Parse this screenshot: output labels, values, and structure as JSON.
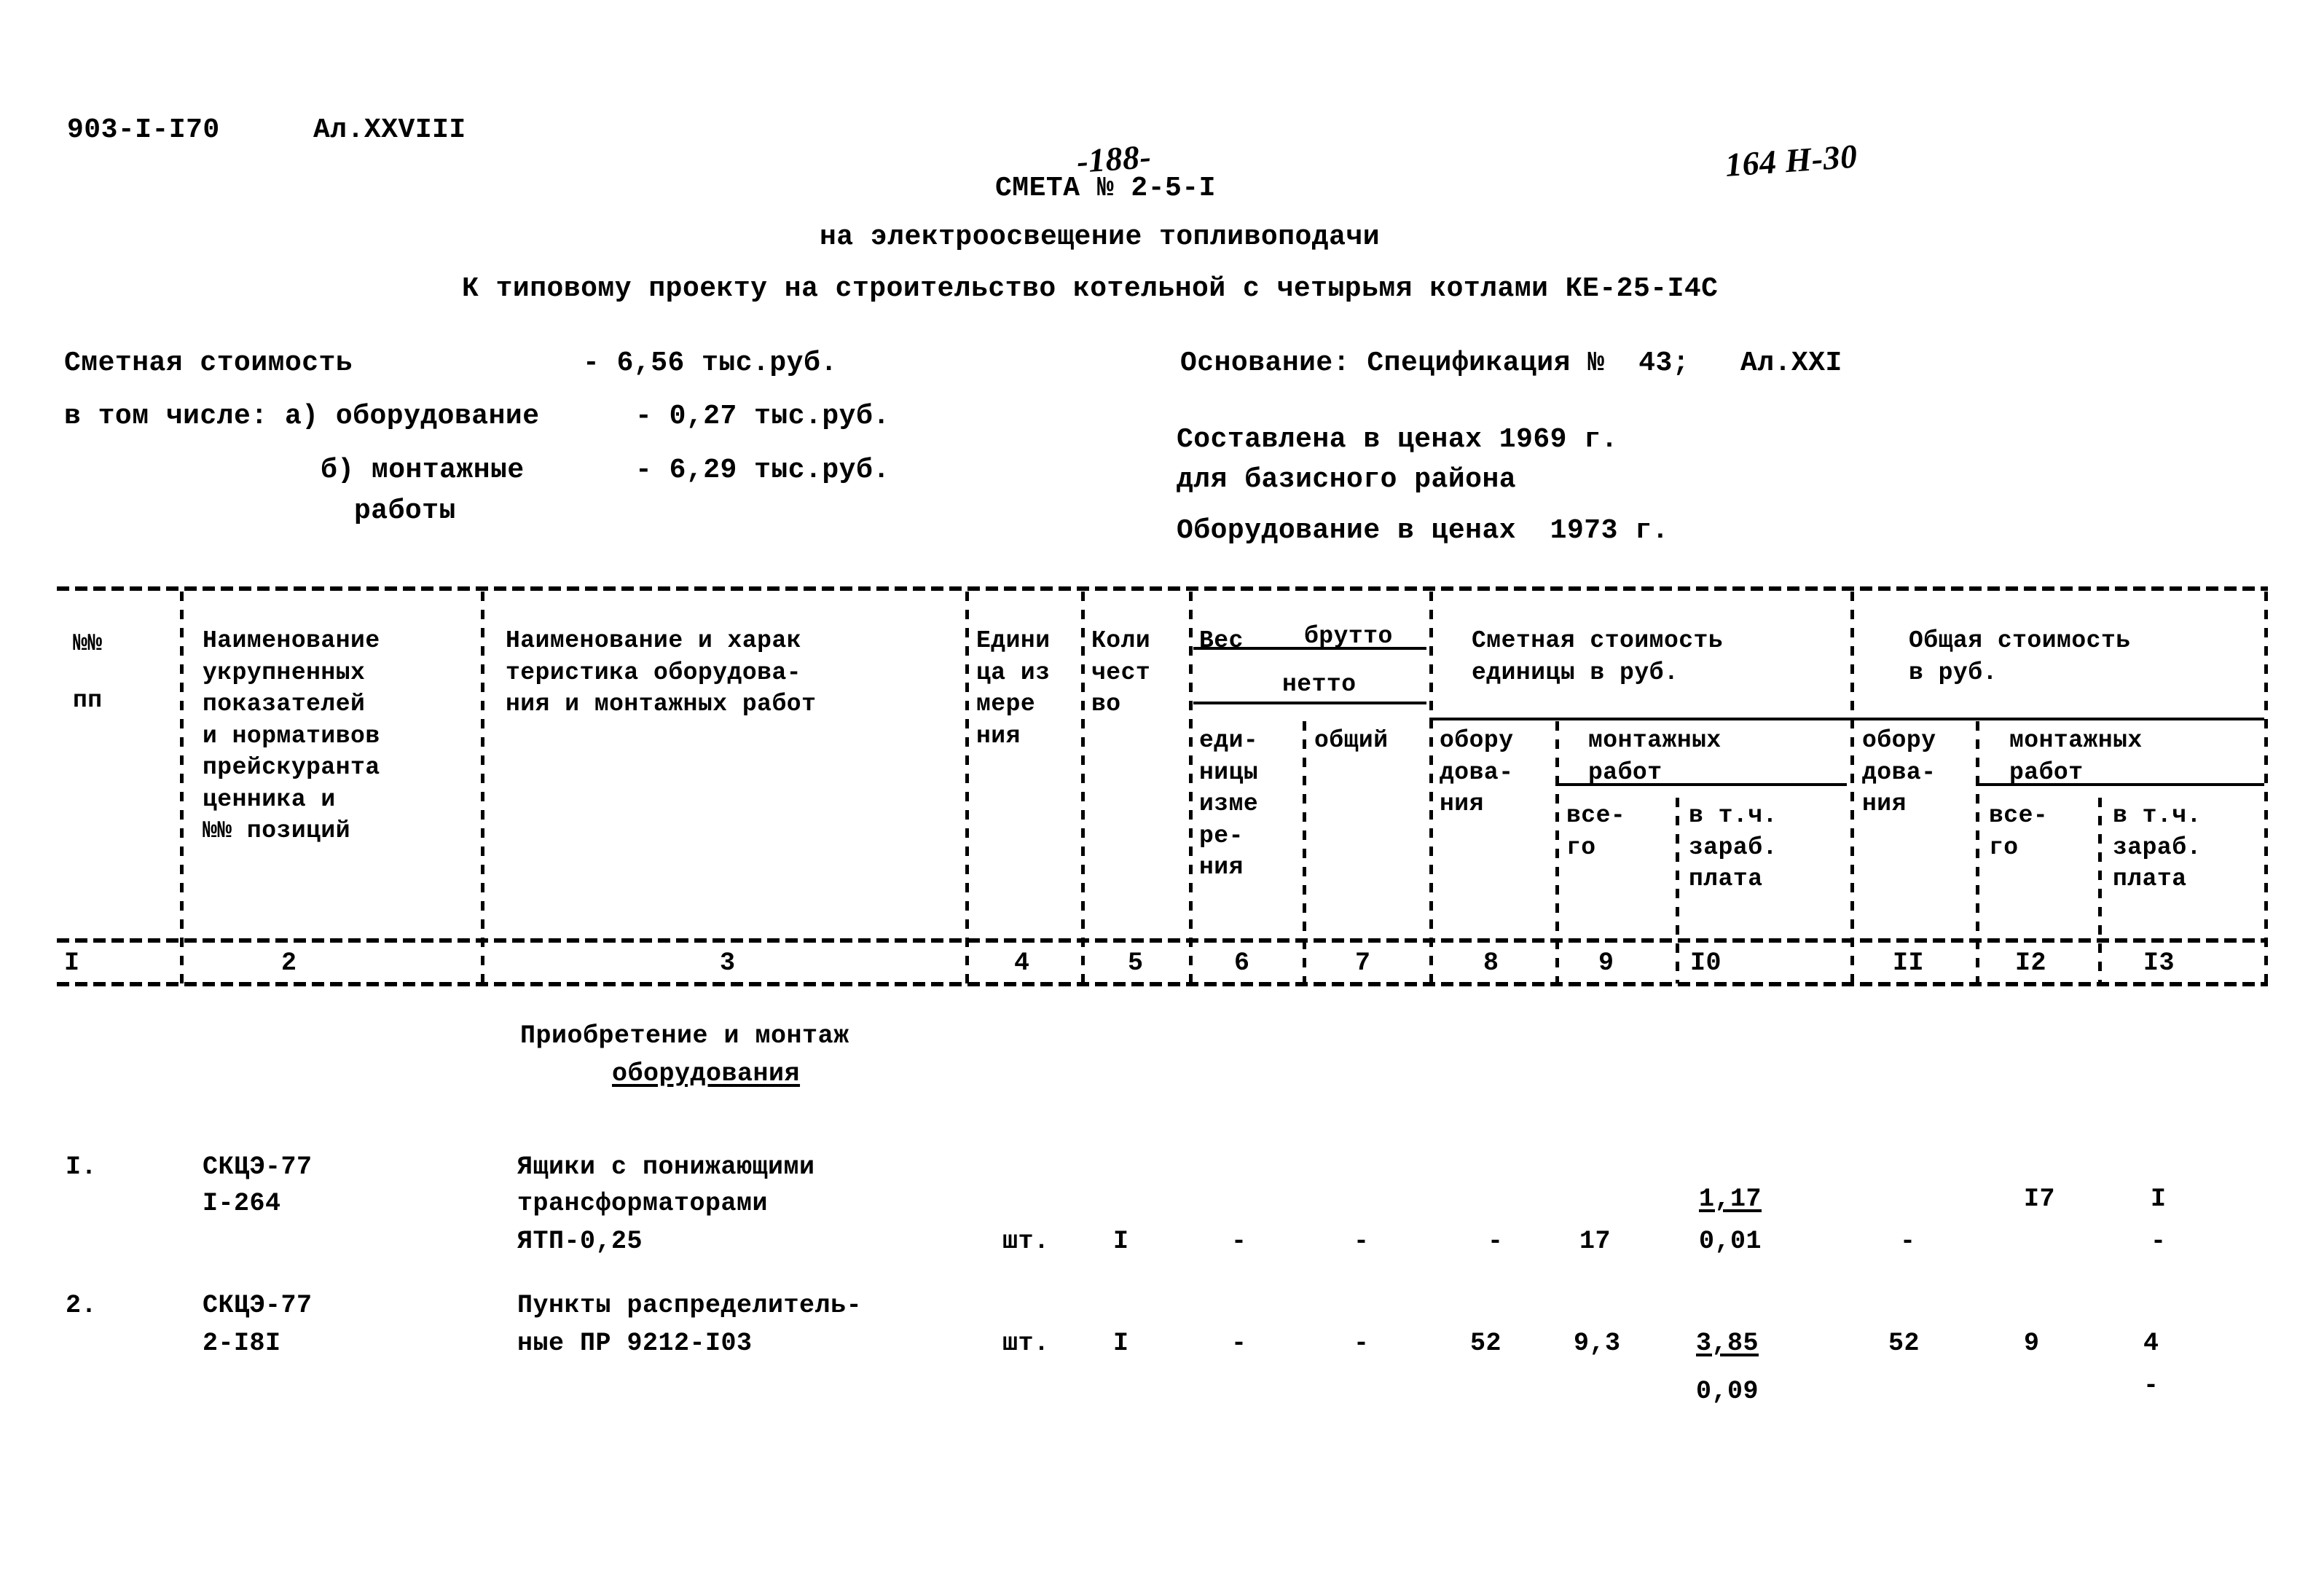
{
  "document": {
    "project_code": "903-I-I70",
    "album": "Ал.XXVIII",
    "page_number": "-188-",
    "sheet_code": "164 Н-30",
    "title_line1": "СМЕТА № 2-5-I",
    "title_line2": "на электроосвещение топливоподачи",
    "title_line3": "К типовому проекту на строительство котельной с четырьмя котлами КЕ-25-I4C"
  },
  "summary_left": {
    "total_label": "Сметная стоимость",
    "total_value": "- 6,56 тыс.руб.",
    "breakdown_label": "в том числе: а) оборудование",
    "breakdown_value": "- 0,27 тыс.руб.",
    "works_label_a": "б) монтажные",
    "works_label_b": "работы",
    "works_value": "- 6,29 тыс.руб."
  },
  "summary_right": {
    "basis": "Основание: Спецификация №  43;   Ал.XXI",
    "prices_line1": "Составлена в ценах 1969 г.",
    "prices_line2": "для базисного района",
    "prices_line3": "Оборудование в ценах  1973 г."
  },
  "table": {
    "headers": {
      "c1_a": "№№",
      "c1_b": "пп",
      "c2": "Наименование\nукрупненных\nпоказателей\nи нормативов\nпрейскуранта\nценника и\n№№ позиций",
      "c3": "Наименование и харак\nтеристика оборудова-\nния и монтажных работ",
      "c4": "Едини\nца из\nмере\nния",
      "c5": "Коли\nчест\nво",
      "c6_7_group_a": "Вес",
      "c6_7_group_brutto": "брутто",
      "c6_7_group_netto": "нетто",
      "c6": "еди-\nницы\nизме\nре-\nния",
      "c7": "общий",
      "c8_10_group": "Сметная стоимость\nединицы в руб.",
      "c8": "обору\nдова-\nния",
      "c9_10_group": "монтажных\nработ",
      "c9": "все-\nго",
      "c10": "в т.ч.\nзараб.\nплата",
      "c11_13_group": "Общая стоимость\nв руб.",
      "c11": "обору\nдова-\nния",
      "c12_13_group": "монтажных\nработ",
      "c12": "все-\nго",
      "c13": "в т.ч.\nзараб.\nплата"
    },
    "column_numbers": [
      "I",
      "2",
      "3",
      "4",
      "5",
      "6",
      "7",
      "8",
      "9",
      "I0",
      "II",
      "I2",
      "I3"
    ],
    "section_title_line1": "Приобретение и монтаж",
    "section_title_line2": "оборудования",
    "rows": [
      {
        "num": "I.",
        "code_line1": "СКЦЭ-77",
        "code_line2": "I-264",
        "desc_line1": "Ящики с понижающими",
        "desc_line2": "трансформаторами",
        "desc_line3": "ЯТП-0,25",
        "unit": "шт.",
        "qty": "I",
        "c6": "-",
        "c7": "-",
        "c8": "-",
        "c9": "17",
        "c10_top": "1,17",
        "c10_bottom": "0,01",
        "c11": "-",
        "c12": "I7",
        "c13_top": "I",
        "c13_bottom": "-"
      },
      {
        "num": "2.",
        "code_line1": "СКЦЭ-77",
        "code_line2": "2-I8I",
        "desc_line1": "Пункты распределитель-",
        "desc_line2": "ные ПР 9212-I03",
        "desc_line3": "",
        "unit": "шт.",
        "qty": "I",
        "c6": "-",
        "c7": "-",
        "c8": "52",
        "c9": "9,3",
        "c10_top": "3,85",
        "c10_bottom": "0,09",
        "c11": "52",
        "c12": "9",
        "c13_top": "4",
        "c13_bottom": "-"
      }
    ]
  }
}
